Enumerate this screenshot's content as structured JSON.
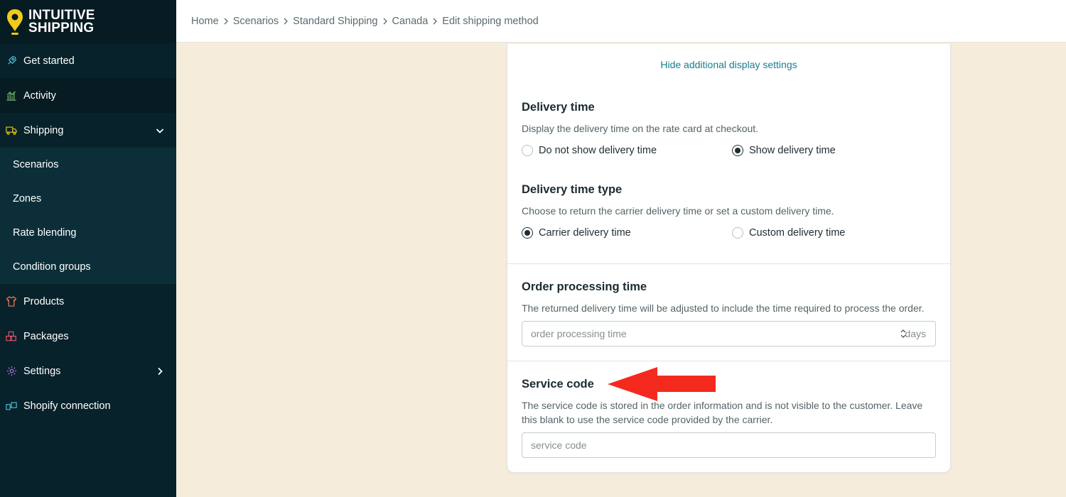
{
  "brand": {
    "line1": "INTUITIVE",
    "line2": "SHIPPING",
    "accent": "#f3c91b"
  },
  "sidebar": {
    "items": [
      {
        "label": "Get started",
        "icon": "rocket-icon"
      },
      {
        "label": "Activity",
        "icon": "chart-icon"
      },
      {
        "label": "Shipping",
        "icon": "truck-icon"
      },
      {
        "label": "Products",
        "icon": "shirt-icon"
      },
      {
        "label": "Packages",
        "icon": "boxes-icon"
      },
      {
        "label": "Settings",
        "icon": "gear-icon"
      },
      {
        "label": "Shopify connection",
        "icon": "shopify-icon"
      }
    ],
    "shipping_sub": [
      "Scenarios",
      "Zones",
      "Rate blending",
      "Condition groups"
    ]
  },
  "breadcrumb": [
    "Home",
    "Scenarios",
    "Standard Shipping",
    "Canada",
    "Edit shipping method"
  ],
  "card": {
    "hide_link": "Hide additional display settings",
    "delivery_time": {
      "title": "Delivery time",
      "desc": "Display the delivery time on the rate card at checkout.",
      "option_a": "Do not show delivery time",
      "option_b": "Show delivery time",
      "selected": "option_b"
    },
    "delivery_time_type": {
      "title": "Delivery time type",
      "desc": "Choose to return the carrier delivery time or set a custom delivery time.",
      "option_a": "Carrier delivery time",
      "option_b": "Custom delivery time",
      "selected": "option_a"
    },
    "order_processing": {
      "title": "Order processing time",
      "desc": "The returned delivery time will be adjusted to include the time required to process the order.",
      "placeholder": "order processing time",
      "value": "",
      "suffix": "days"
    },
    "service_code": {
      "title": "Service code",
      "desc": "The service code is stored in the order information and is not visible to the customer. Leave this blank to use the service code provided by the carrier.",
      "placeholder": "service code",
      "value": ""
    }
  },
  "colors": {
    "sidebar_bg": "#08222b",
    "page_bg": "#f6ecdc",
    "link": "#177e8e",
    "annotation_arrow": "#f42a1e"
  }
}
